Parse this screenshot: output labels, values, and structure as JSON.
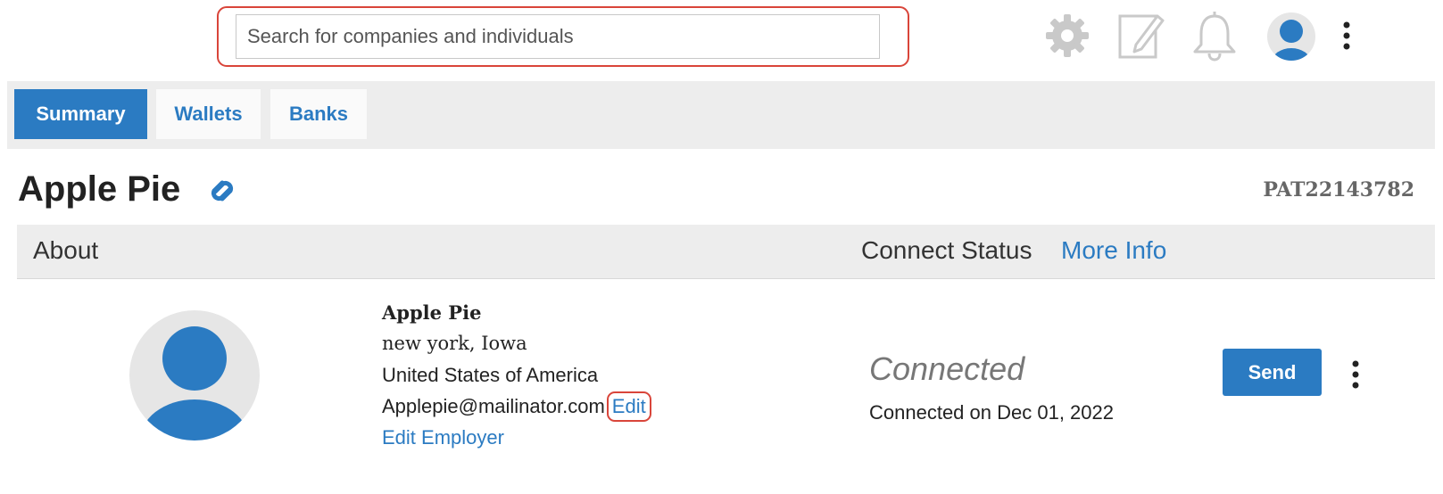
{
  "search": {
    "placeholder": "Search for companies and individuals",
    "value": ""
  },
  "header_icons": [
    "gear-icon",
    "edit-note-icon",
    "bell-icon",
    "user-avatar-icon",
    "more-vertical-icon"
  ],
  "tabs": [
    {
      "label": "Summary",
      "active": true
    },
    {
      "label": "Wallets",
      "active": false
    },
    {
      "label": "Banks",
      "active": false
    }
  ],
  "profile": {
    "name": "Apple Pie",
    "id": "PAT22143782",
    "link_icon": "linked-chain-icon"
  },
  "section": {
    "about_label": "About",
    "connect_status_label": "Connect Status",
    "more_info_label": "More Info"
  },
  "details": {
    "name": "Apple Pie",
    "city_state": "new york, Iowa",
    "country": "United States of America",
    "email": "Applepie@mailinator.com",
    "edit_label": "Edit",
    "edit_employer_label": "Edit Employer"
  },
  "status": {
    "value": "Connected",
    "date_text": "Connected on Dec 01, 2022",
    "send_label": "Send"
  },
  "colors": {
    "accent": "#2b7bc2",
    "highlight": "#d9453a",
    "panel_bg": "#ededed"
  }
}
